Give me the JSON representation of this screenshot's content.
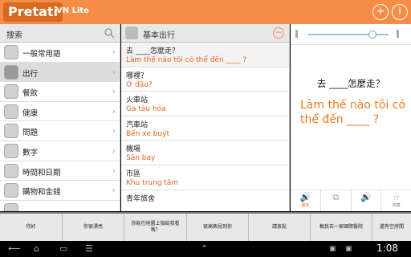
{
  "app": {
    "logo": "Pretati",
    "subtitle": "VN Lite"
  },
  "titlebar": {
    "add_icon": "+",
    "info_icon": "i"
  },
  "sidebar": {
    "search_label": "搜索",
    "items": [
      {
        "label": "一般常用語",
        "icon": "mobile-icon"
      },
      {
        "label": "出行",
        "icon": "turn-arrow-icon",
        "selected": true
      },
      {
        "label": "餐飲",
        "icon": "food-icon"
      },
      {
        "label": "健康",
        "icon": "health-icon"
      },
      {
        "label": "問題",
        "icon": "problem-icon"
      },
      {
        "label": "數字",
        "icon": "numbers-icon"
      },
      {
        "label": "時間和日期",
        "icon": "clock-icon"
      },
      {
        "label": "購物和金錢",
        "icon": "shopping-icon"
      },
      {
        "label": "",
        "icon": "more-icon"
      }
    ]
  },
  "middle": {
    "header": "基本出行",
    "phrases": [
      {
        "zh": "去 ____怎麼走？",
        "vi": "Làm thế nào tôi có thể đến ____ ?",
        "selected": true
      },
      {
        "zh": "哪裡？",
        "vi": "Ở đâu?"
      },
      {
        "zh": "火車站",
        "vi": "Ga tàu hỏa"
      },
      {
        "zh": "汽車站",
        "vi": "Bến xe buýt"
      },
      {
        "zh": "機場",
        "vi": "Sân bay"
      },
      {
        "zh": "市區",
        "vi": "Khu trung tâm"
      },
      {
        "zh": "青年旅舍",
        "vi": ""
      }
    ]
  },
  "detail": {
    "volume_level": 0.8,
    "zh": "去 ____怎麼走？",
    "vi": "Làm thế nào tôi có thể đến ____ ?",
    "tools": [
      {
        "glyph": "🔊",
        "caption": "播放"
      },
      {
        "glyph": "⧉",
        "caption": ""
      },
      {
        "glyph": "🔊",
        "caption": ""
      },
      {
        "glyph": "☆",
        "caption": "收藏"
      }
    ]
  },
  "strip": [
    "你好",
    "你很漂亮",
    "你能在地圖上指給我看嗎？",
    "很高興見到你",
    "請放鬆",
    "載我去一家國際醫院",
    "還有空房間"
  ],
  "navbar": {
    "time": "1:08"
  },
  "colors": {
    "accent": "#f58d47",
    "vi_text": "#e8631a"
  }
}
